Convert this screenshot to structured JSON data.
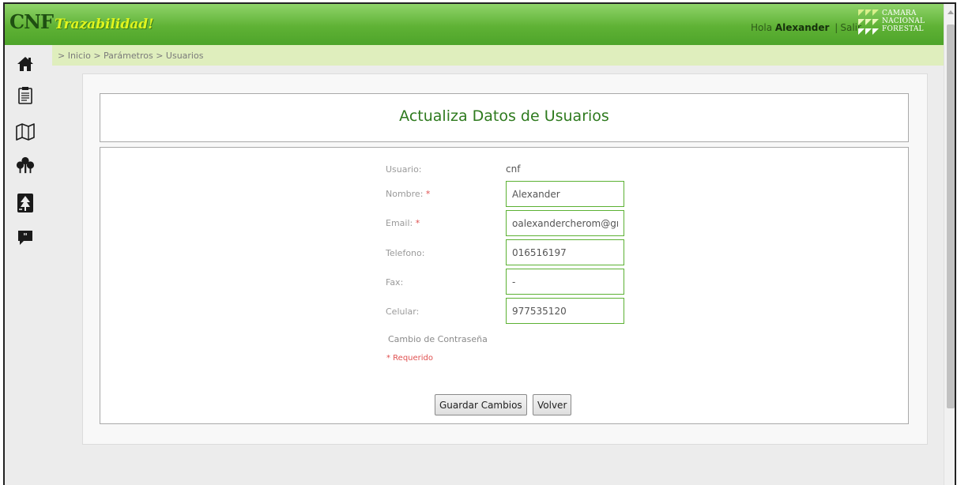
{
  "header": {
    "brand_main": "CNF",
    "brand_sub": "Trazabilidad!",
    "greeting_prefix": "Hola",
    "user_name": "Alexander",
    "separator": "|",
    "logout_label": "Salir",
    "logo_lines": [
      "CAMARA",
      "NACIONAL",
      "FORESTAL"
    ]
  },
  "breadcrumb": "> Inicio > Parámetros > Usuarios",
  "sidebar": {
    "items": [
      {
        "icon": "home-icon"
      },
      {
        "icon": "clipboard-icon"
      },
      {
        "icon": "map-icon"
      },
      {
        "icon": "trees-icon"
      },
      {
        "icon": "forest-transfer-icon"
      },
      {
        "icon": "comment-icon"
      }
    ]
  },
  "form": {
    "title": "Actualiza Datos de Usuarios",
    "usuario_label": "Usuario:",
    "usuario_value": "cnf",
    "nombre_label": "Nombre:",
    "nombre_value": "Alexander",
    "email_label": "Email:",
    "email_value": "oalexandercherom@gma",
    "telefono_label": "Telefono:",
    "telefono_value": "016516197",
    "fax_label": "Fax:",
    "fax_value": "-",
    "celular_label": "Celular:",
    "celular_value": "977535120",
    "required_mark": "*",
    "password_link": "Cambio de Contraseña",
    "required_note": "* Requerido",
    "save_label": "Guardar Cambios",
    "back_label": "Volver"
  },
  "colors": {
    "header_green": "#5fb235",
    "breadcrumb_bg": "#dfeebd",
    "title_green": "#2e7a1e",
    "input_border": "#5cb133",
    "required_red": "#e05050"
  }
}
